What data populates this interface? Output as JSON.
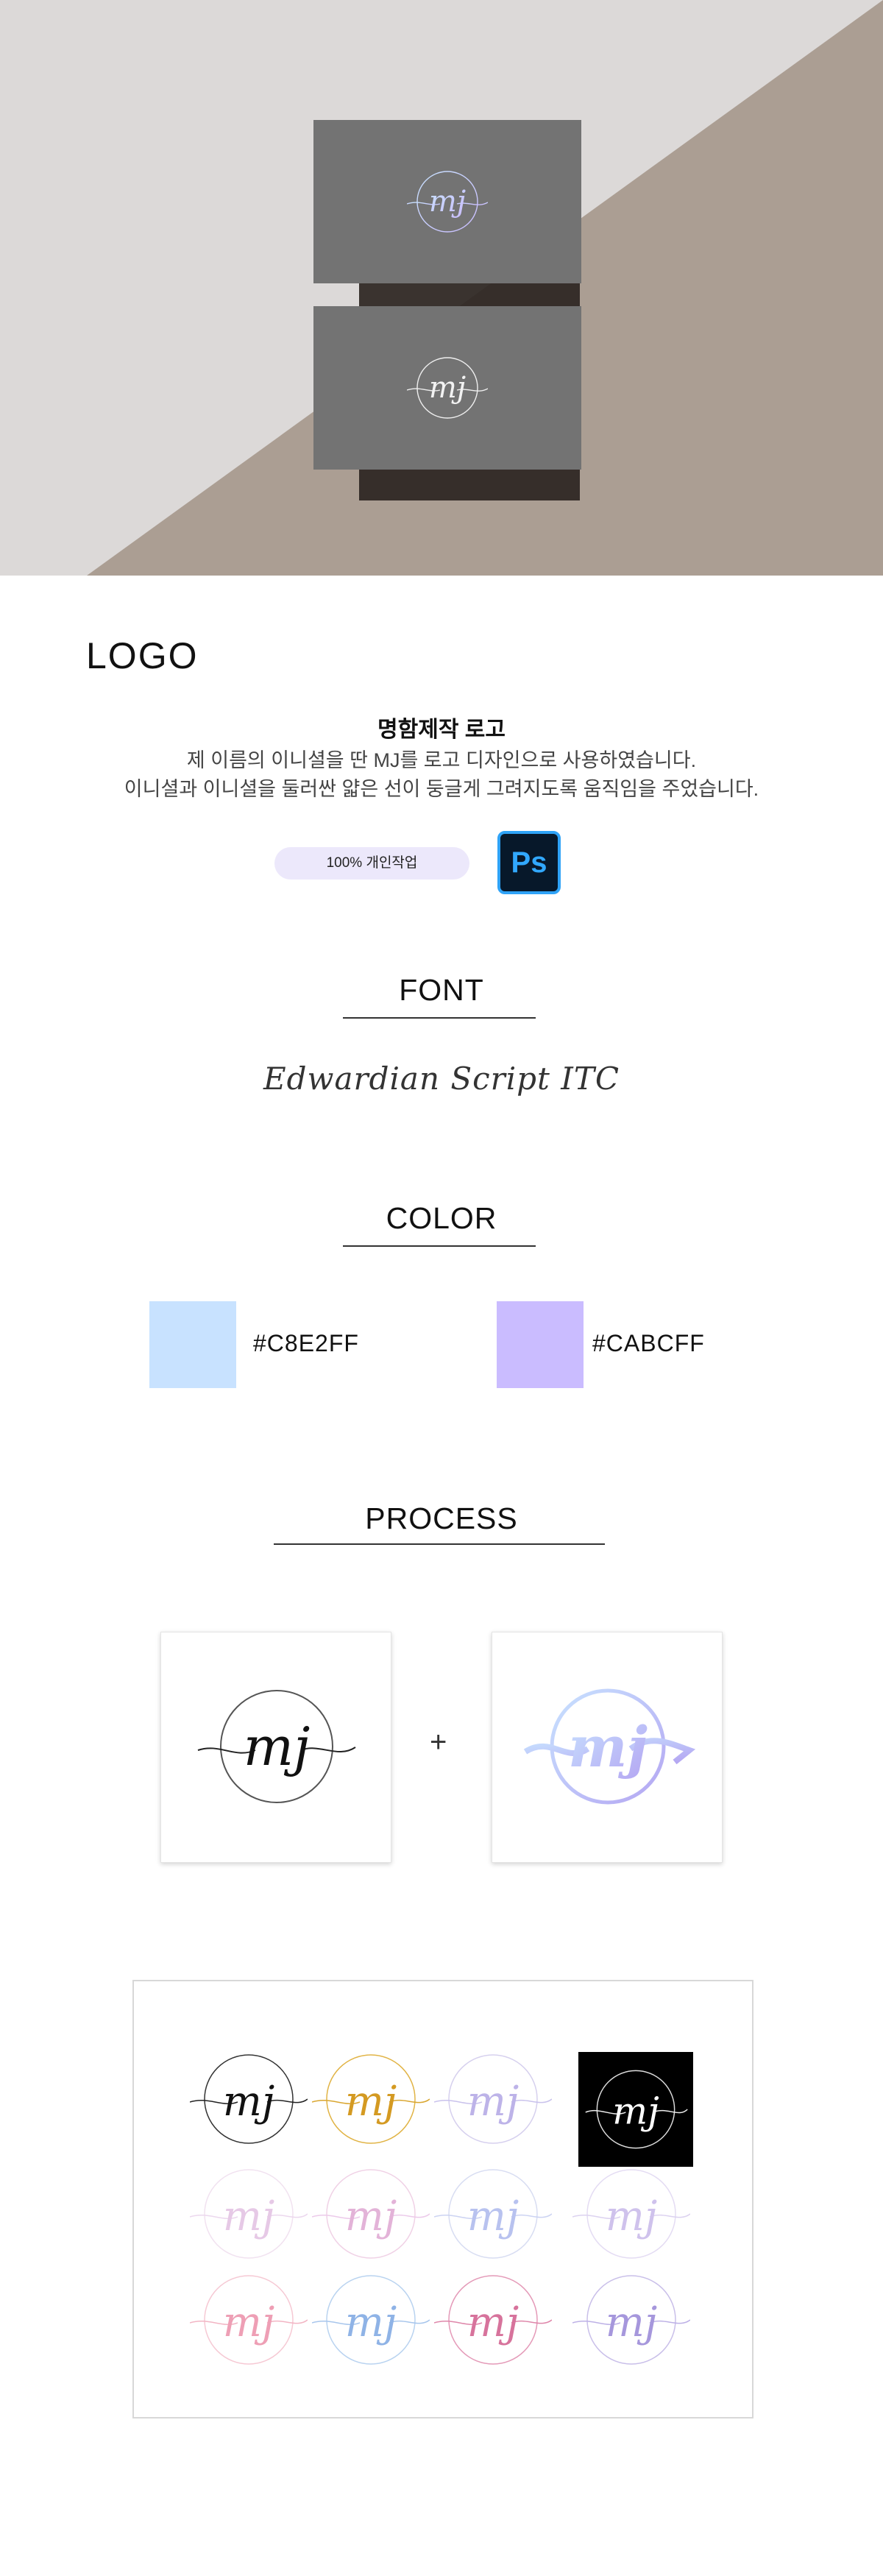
{
  "logo_section": {
    "title": "LOGO",
    "heading": "명함제작 로고",
    "lines": [
      "제 이름의 이니셜을 딴 MJ를 로고 디자인으로 사용하였습니다.",
      "이니셜과 이니셜을 둘러싼 얇은 선이 둥글게 그려지도록 움직임을 주었습니다."
    ],
    "badge": "100% 개인작업",
    "tool_icon": "photoshop-icon",
    "tool_label": "Ps"
  },
  "logo_mark": "mj",
  "font_section": {
    "title": "FONT",
    "font_name": "Edwardian Script ITC"
  },
  "color_section": {
    "title": "COLOR",
    "colors": [
      {
        "hex": "#C8E2FF",
        "label": "#C8E2FF"
      },
      {
        "hex": "#CABCFF",
        "label": "#CABCFF"
      }
    ]
  },
  "process_section": {
    "title": "PROCESS",
    "operator": "+"
  },
  "hero_colors": {
    "background": "#dcd9d8",
    "taupe": "#ab9e93",
    "card": "#737373",
    "shadow": "#2b2521"
  }
}
